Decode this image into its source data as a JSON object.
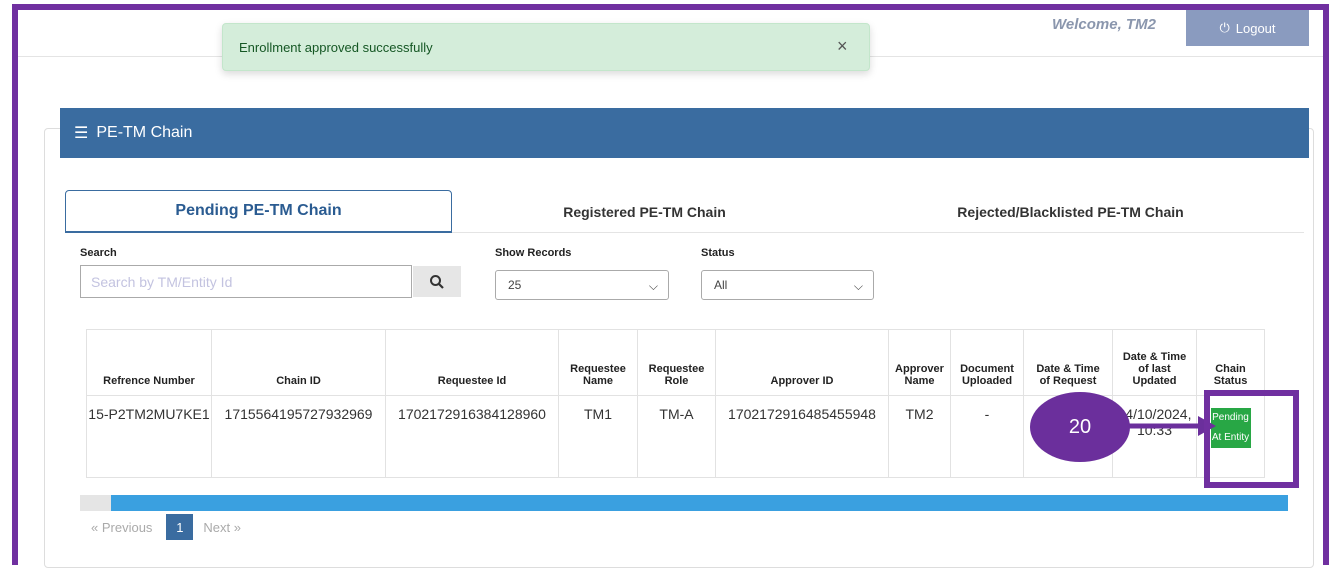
{
  "header": {
    "welcome": "Welcome, TM2",
    "logout_label": "Logout"
  },
  "toast": {
    "message": "Enrollment approved successfully",
    "close": "×"
  },
  "panel": {
    "title": "PE-TM Chain"
  },
  "tabs": [
    {
      "label": "Pending PE-TM Chain"
    },
    {
      "label": "Registered PE-TM Chain"
    },
    {
      "label": "Rejected/Blacklisted PE-TM Chain"
    }
  ],
  "filters": {
    "search_label": "Search",
    "search_placeholder": "Search by TM/Entity Id",
    "records_label": "Show Records",
    "records_value": "25",
    "status_label": "Status",
    "status_value": "All"
  },
  "table": {
    "headers": [
      "Refrence Number",
      "Chain ID",
      "Requestee Id",
      "Requestee Name",
      "Requestee Role",
      "Approver ID",
      "Approver Name",
      "Document Uploaded",
      "Date & Time of Request",
      "Date & Time of last Updated",
      "Chain Status"
    ],
    "row": {
      "ref": "15-P2TM2MU7KE1",
      "chain_id": "1715564195727932969",
      "requestee_id": "1702172916384128960",
      "name": "TM1",
      "role": "TM-A",
      "approver_id": "1702172916485455948",
      "approver_name": "TM2",
      "document": "-",
      "request_time": "",
      "updated_time": "24/10/2024, 10:33",
      "status": "Pending At Entity"
    }
  },
  "pager": {
    "previous": "« Previous",
    "page": "1",
    "next": "Next »"
  },
  "annotation": {
    "step": "20"
  },
  "colors": {
    "frame": "#7030a0",
    "header": "#3a6ca0",
    "status": "#28a745"
  }
}
